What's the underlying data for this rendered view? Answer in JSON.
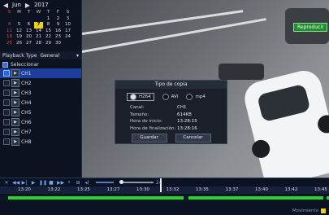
{
  "calendar": {
    "month": "Jun",
    "year": "2017",
    "days_header": [
      "S",
      "M",
      "T",
      "W",
      "T",
      "F",
      "S"
    ],
    "weeks": [
      [
        "",
        "",
        "",
        "",
        "1",
        "2",
        "3"
      ],
      [
        "4",
        "5",
        "6",
        "7",
        "8",
        "9",
        "10"
      ],
      [
        "11",
        "12",
        "13",
        "14",
        "15",
        "16",
        "17"
      ],
      [
        "18",
        "19",
        "20",
        "21",
        "22",
        "23",
        "24"
      ],
      [
        "25",
        "26",
        "27",
        "28",
        "29",
        "30",
        ""
      ]
    ],
    "selected_day": "7"
  },
  "playback_type": {
    "label": "Playback Type",
    "value": "General"
  },
  "select_all_label": "Seleccionar",
  "channels": [
    "CH1",
    "CH2",
    "CH3",
    "CH4",
    "CH5",
    "CH6",
    "CH7",
    "CH8"
  ],
  "active_channel": "CH1",
  "video": {
    "badge": "Reproducir"
  },
  "dialog": {
    "title": "Tipo de copia",
    "options": [
      "H264",
      "AVI",
      "mp4"
    ],
    "selected_option": "H264",
    "rows": [
      {
        "label": "Canal:",
        "value": "CH1"
      },
      {
        "label": "Tamaño:",
        "value": "614KB"
      },
      {
        "label": "Hora de inicio:",
        "value": "13:28:15"
      },
      {
        "label": "Hora de finalización:",
        "value": "13:28:16"
      }
    ],
    "save_label": "Guardar",
    "cancel_label": "Cancelar"
  },
  "timeline": {
    "scale_end": "24",
    "ticks": [
      "13:20",
      "13:22",
      "13:25",
      "13:27",
      "13:30",
      "13:32",
      "13:35",
      "13:37",
      "13:40",
      "13:42",
      "13:45"
    ],
    "status_left": "",
    "status_right": "Movimiento"
  },
  "colors": {
    "record": "#2ad42a",
    "accent": "#1b3f9a",
    "badge": "#1f8f2f",
    "selected_day": "#e8d21a"
  }
}
